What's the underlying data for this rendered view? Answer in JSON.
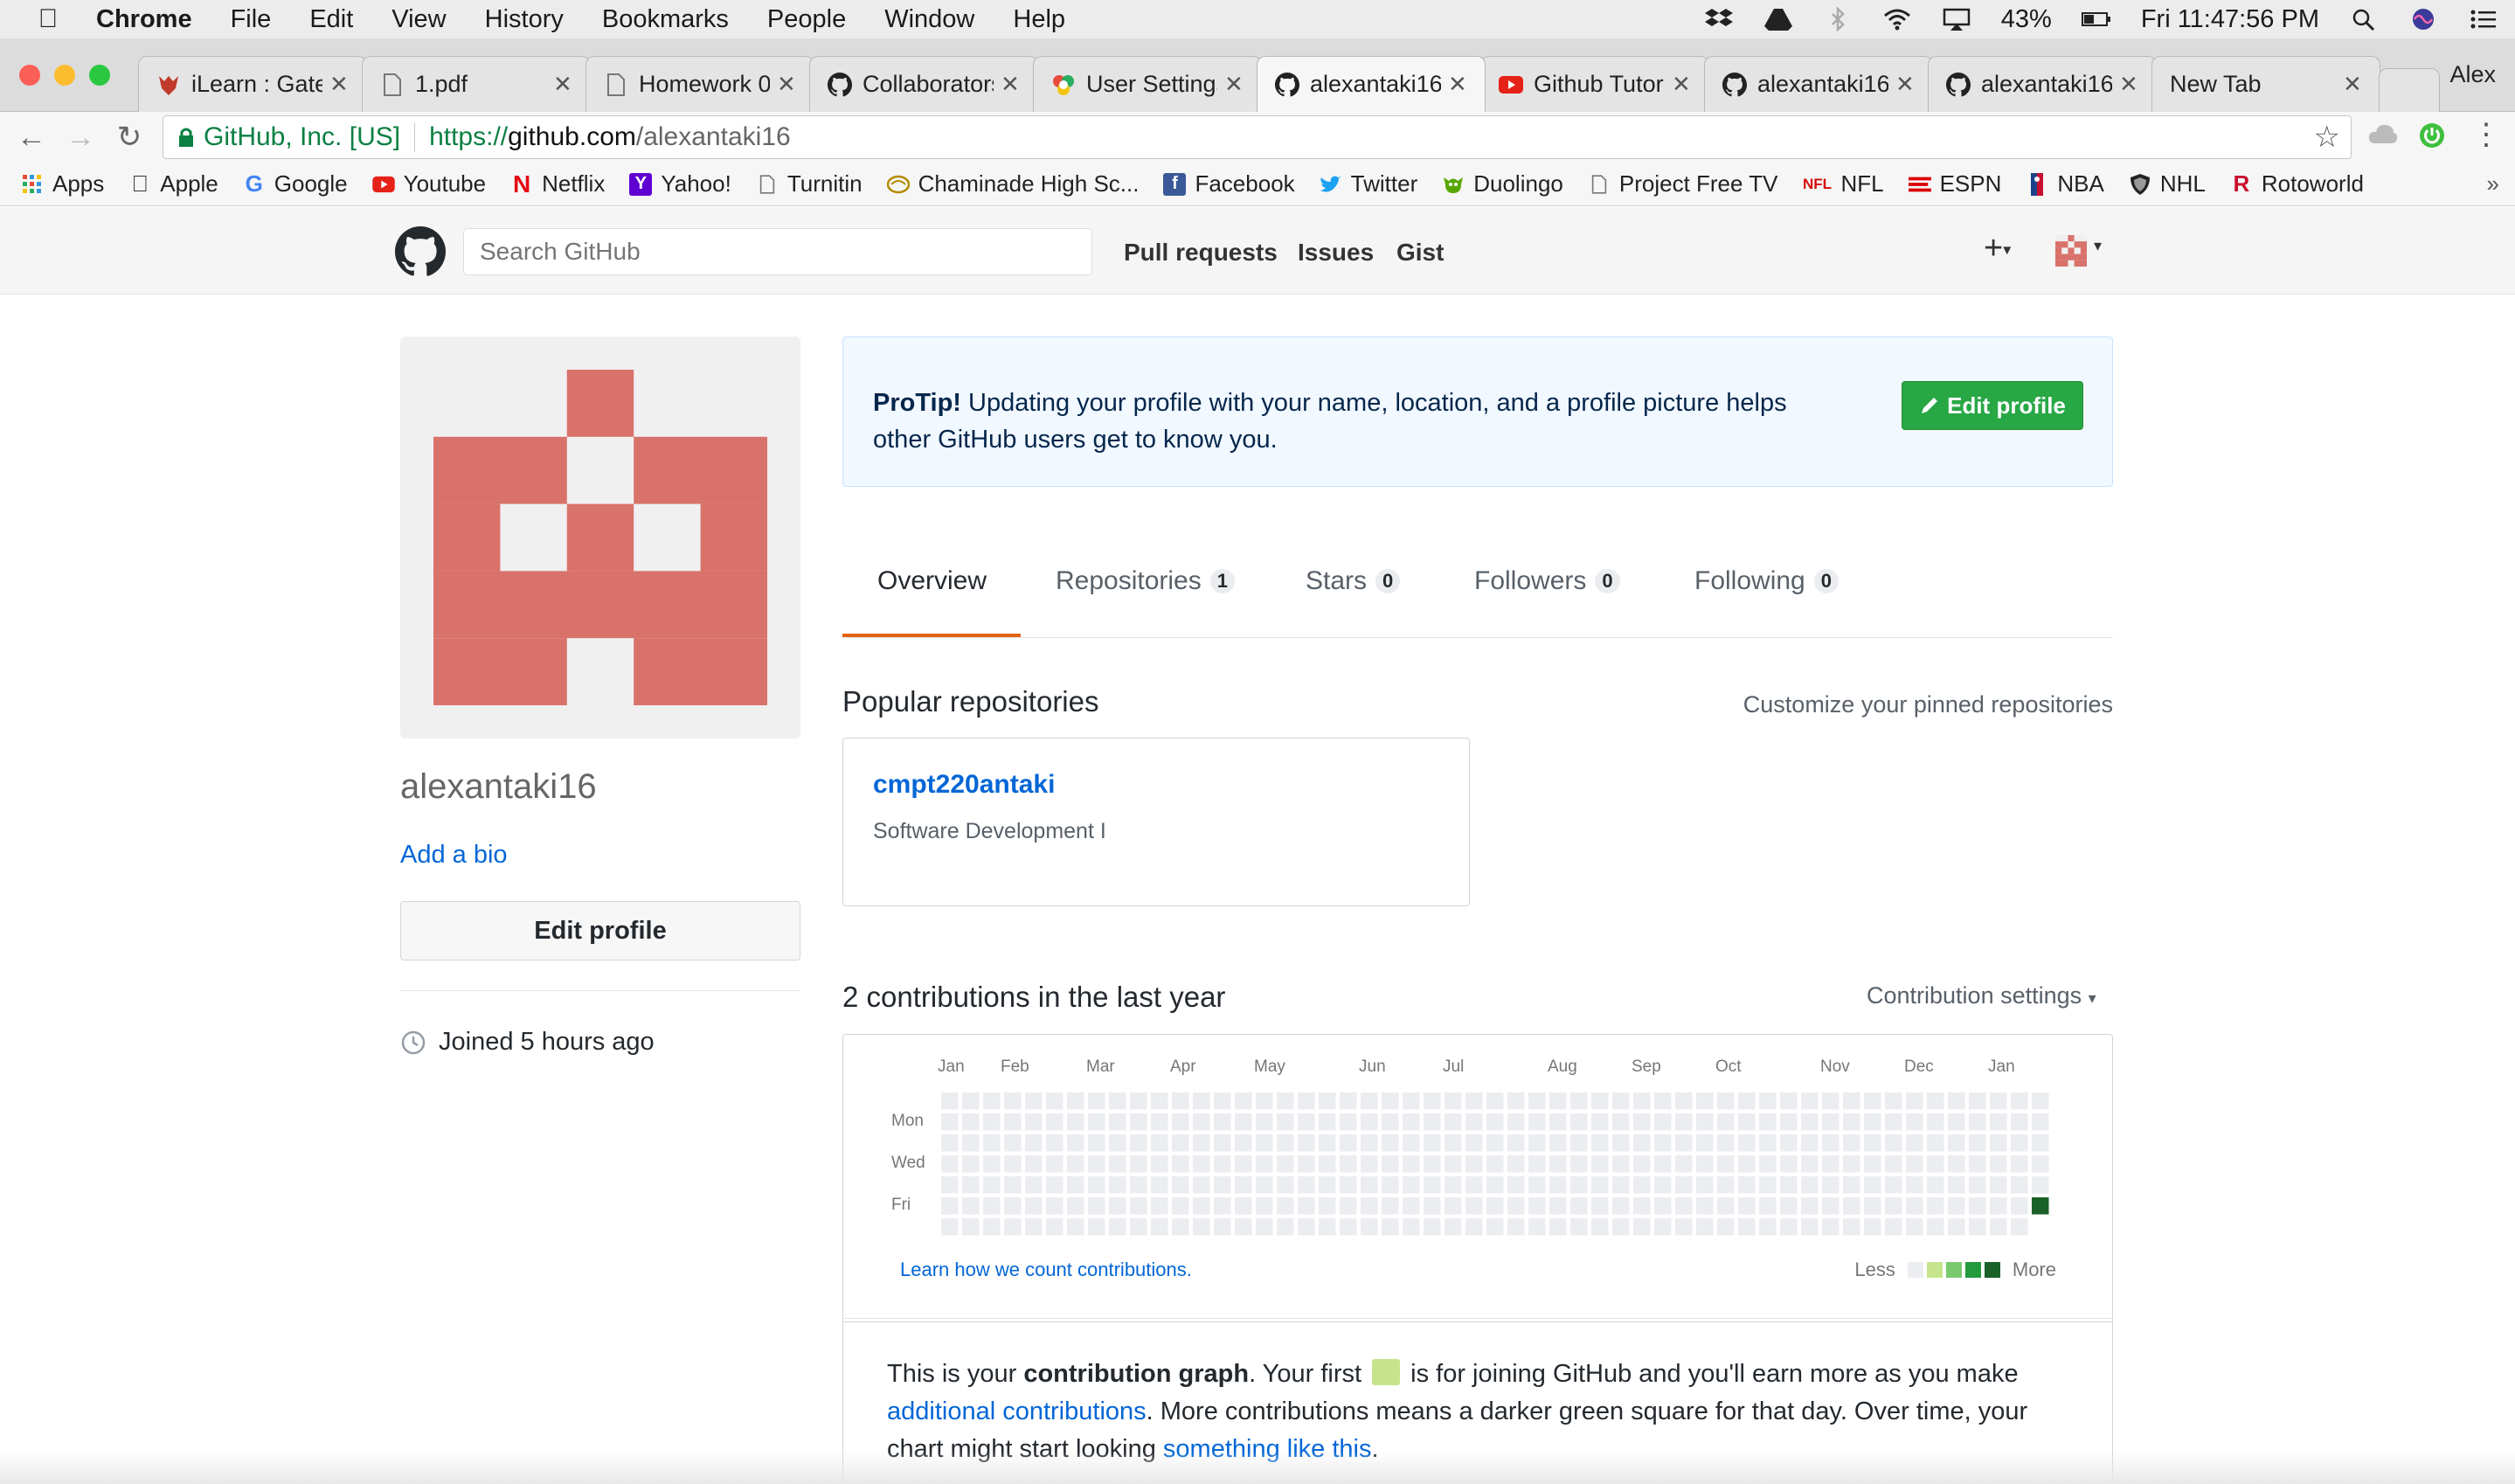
{
  "menubar": {
    "app": "Chrome",
    "items": [
      "File",
      "Edit",
      "View",
      "History",
      "Bookmarks",
      "People",
      "Window",
      "Help"
    ],
    "battery": "43%",
    "clock": "Fri 11:47:56 PM"
  },
  "tabs": [
    {
      "title": "iLearn : Gate",
      "icon": "ilearn-icon"
    },
    {
      "title": "1.pdf",
      "icon": "document-icon"
    },
    {
      "title": "Homework 0",
      "icon": "document-icon"
    },
    {
      "title": "Collaborators",
      "icon": "github-icon"
    },
    {
      "title": "User Settings",
      "icon": "settings-icon"
    },
    {
      "title": "alexantaki16",
      "icon": "github-icon",
      "active": true
    },
    {
      "title": "Github Tutor",
      "icon": "youtube-icon"
    },
    {
      "title": "alexantaki16",
      "icon": "github-icon"
    },
    {
      "title": "alexantaki16",
      "icon": "github-icon"
    },
    {
      "title": "New Tab",
      "icon": ""
    }
  ],
  "profile_name": "Alex",
  "address": {
    "secure_label": "GitHub, Inc. [US]",
    "scheme": "https://",
    "host": "github.com",
    "path": "/alexantaki16"
  },
  "bookmarks": [
    {
      "label": "Apps",
      "icon": "apps-icon"
    },
    {
      "label": "Apple",
      "icon": "apple-icon"
    },
    {
      "label": "Google",
      "icon": "google-icon"
    },
    {
      "label": "Youtube",
      "icon": "youtube-icon"
    },
    {
      "label": "Netflix",
      "icon": "netflix-icon"
    },
    {
      "label": "Yahoo!",
      "icon": "yahoo-icon"
    },
    {
      "label": "Turnitin",
      "icon": "document-icon"
    },
    {
      "label": "Chaminade High Sc...",
      "icon": "school-icon"
    },
    {
      "label": "Facebook",
      "icon": "facebook-icon"
    },
    {
      "label": "Twitter",
      "icon": "twitter-icon"
    },
    {
      "label": "Duolingo",
      "icon": "duolingo-icon"
    },
    {
      "label": "Project Free TV",
      "icon": "document-icon"
    },
    {
      "label": "NFL",
      "icon": "nfl-icon"
    },
    {
      "label": "ESPN",
      "icon": "espn-icon"
    },
    {
      "label": "NBA",
      "icon": "nba-icon"
    },
    {
      "label": "NHL",
      "icon": "nhl-icon"
    },
    {
      "label": "Rotoworld",
      "icon": "rotoworld-icon"
    }
  ],
  "github": {
    "search_placeholder": "Search GitHub",
    "nav": [
      "Pull requests",
      "Issues",
      "Gist"
    ]
  },
  "profile": {
    "username": "alexantaki16",
    "add_bio": "Add a bio",
    "edit_profile": "Edit profile",
    "joined": "Joined 5 hours ago"
  },
  "protip": {
    "lead": "ProTip!",
    "text": " Updating your profile with your name, location, and a profile picture helps other GitHub users get to know you.",
    "button": "Edit profile"
  },
  "profile_tabs": [
    {
      "label": "Overview",
      "count": ""
    },
    {
      "label": "Repositories",
      "count": "1"
    },
    {
      "label": "Stars",
      "count": "0"
    },
    {
      "label": "Followers",
      "count": "0"
    },
    {
      "label": "Following",
      "count": "0"
    }
  ],
  "popular": {
    "title": "Popular repositories",
    "customize": "Customize your pinned repositories",
    "repo_name": "cmpt220antaki",
    "repo_desc": "Software Development I"
  },
  "contributions": {
    "title": "2 contributions in the last year",
    "settings": "Contribution settings",
    "months": [
      "Jan",
      "Feb",
      "Mar",
      "Apr",
      "May",
      "Jun",
      "Jul",
      "Aug",
      "Sep",
      "Oct",
      "Nov",
      "Dec",
      "Jan"
    ],
    "days": [
      "Mon",
      "Wed",
      "Fri"
    ],
    "learn": "Learn how we count contributions.",
    "less": "Less",
    "more": "More",
    "colors": [
      "#ebedf0",
      "#c6e48b",
      "#7bc96f",
      "#239a3b",
      "#196127"
    ],
    "explain": {
      "p1": "This is your ",
      "b1": "contribution graph",
      "p2": ". Your first ",
      "p3": " is for joining GitHub and you'll earn more as you make ",
      "link1": "additional contributions",
      "p4": ". More contributions means a darker green square for that day. Over time, your chart might start looking ",
      "link2": "something like this",
      "p5": "."
    }
  }
}
